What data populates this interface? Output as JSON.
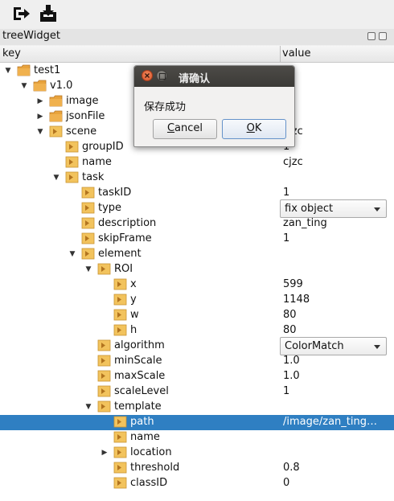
{
  "toolbar": {
    "icons": [
      "exit-icon",
      "save-icon"
    ]
  },
  "dock": {
    "title": "treeWidget"
  },
  "tree": {
    "headers": {
      "key": "key",
      "value": "value"
    },
    "rows": [
      {
        "key": "test1",
        "value": "",
        "level": 0,
        "arrow": "down",
        "icon": "folder"
      },
      {
        "key": "v1.0",
        "value": "",
        "level": 1,
        "arrow": "down",
        "icon": "folder"
      },
      {
        "key": "image",
        "value": "",
        "level": 2,
        "arrow": "right",
        "icon": "folder"
      },
      {
        "key": "jsonFile",
        "value": "",
        "level": 2,
        "arrow": "right",
        "icon": "folder"
      },
      {
        "key": "scene",
        "value": "cjzc",
        "level": 2,
        "arrow": "down",
        "icon": "item"
      },
      {
        "key": "groupID",
        "value": "1",
        "level": 3,
        "arrow": "",
        "icon": "item"
      },
      {
        "key": "name",
        "value": "cjzc",
        "level": 3,
        "arrow": "",
        "icon": "item"
      },
      {
        "key": "task",
        "value": "",
        "level": 3,
        "arrow": "down",
        "icon": "item"
      },
      {
        "key": "taskID",
        "value": "1",
        "level": 4,
        "arrow": "",
        "icon": "item"
      },
      {
        "key": "type",
        "value": "fix object",
        "level": 4,
        "arrow": "",
        "icon": "item",
        "combo": true
      },
      {
        "key": "description",
        "value": "zan_ting",
        "level": 4,
        "arrow": "",
        "icon": "item"
      },
      {
        "key": "skipFrame",
        "value": "1",
        "level": 4,
        "arrow": "",
        "icon": "item"
      },
      {
        "key": "element",
        "value": "",
        "level": 4,
        "arrow": "down",
        "icon": "item"
      },
      {
        "key": "ROI",
        "value": "",
        "level": 5,
        "arrow": "down",
        "icon": "item"
      },
      {
        "key": "x",
        "value": "599",
        "level": 6,
        "arrow": "",
        "icon": "item"
      },
      {
        "key": "y",
        "value": "1148",
        "level": 6,
        "arrow": "",
        "icon": "item"
      },
      {
        "key": "w",
        "value": "80",
        "level": 6,
        "arrow": "",
        "icon": "item"
      },
      {
        "key": "h",
        "value": "80",
        "level": 6,
        "arrow": "",
        "icon": "item"
      },
      {
        "key": "algorithm",
        "value": "ColorMatch",
        "level": 5,
        "arrow": "",
        "icon": "item",
        "combo": true
      },
      {
        "key": "minScale",
        "value": "1.0",
        "level": 5,
        "arrow": "",
        "icon": "item"
      },
      {
        "key": "maxScale",
        "value": "1.0",
        "level": 5,
        "arrow": "",
        "icon": "item"
      },
      {
        "key": "scaleLevel",
        "value": "1",
        "level": 5,
        "arrow": "",
        "icon": "item"
      },
      {
        "key": "template",
        "value": "",
        "level": 5,
        "arrow": "down",
        "icon": "item"
      },
      {
        "key": "path",
        "value": "/image/zan_ting…",
        "level": 6,
        "arrow": "",
        "icon": "item",
        "selected": true
      },
      {
        "key": "name",
        "value": "",
        "level": 6,
        "arrow": "",
        "icon": "item"
      },
      {
        "key": "location",
        "value": "",
        "level": 6,
        "arrow": "right",
        "icon": "item"
      },
      {
        "key": "threshold",
        "value": "0.8",
        "level": 6,
        "arrow": "",
        "icon": "item"
      },
      {
        "key": "classID",
        "value": "0",
        "level": 6,
        "arrow": "",
        "icon": "item"
      }
    ]
  },
  "dialog": {
    "title": "请确认",
    "message": "保存成功",
    "cancel_label": "Cancel",
    "cancel_mnemonic": "C",
    "ok_label": "OK",
    "ok_mnemonic": "O"
  },
  "colors": {
    "selection": "#2f7fc2",
    "folder": "#e8a33c",
    "item_icon": "#f2c35d",
    "close_button": "#e0673c"
  }
}
